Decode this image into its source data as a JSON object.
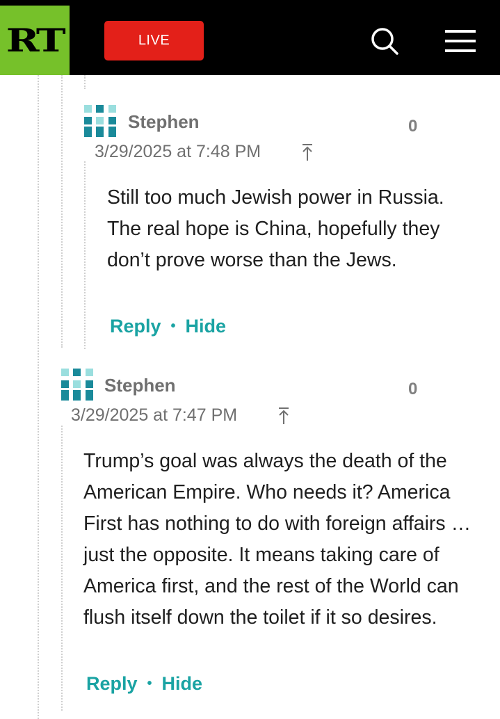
{
  "header": {
    "logo": "RT",
    "live_label": "LIVE"
  },
  "comments": [
    {
      "author": "Stephen",
      "votes": "0",
      "timestamp": "3/29/2025 at 7:48 PM",
      "body": "Still too much Jewish power in Russia. The real hope is China, hopefully they don’t prove worse than the Jews.",
      "reply_label": "Reply",
      "hide_label": "Hide"
    },
    {
      "author": "Stephen",
      "votes": "0",
      "timestamp": "3/29/2025 at 7:47 PM",
      "body": "Trump’s goal was always the death of the American Empire. Who needs it? America First has nothing to do with foreign affairs … just the opposite. It means taking care of America first, and the rest of the World can flush itself down the toilet if it so desires.",
      "reply_label": "Reply",
      "hide_label": "Hide"
    }
  ],
  "colors": {
    "header_bg": "#000000",
    "logo_bg": "#76c12a",
    "live_bg": "#e32019",
    "action_link": "#1aa3a3",
    "muted_text": "#707070"
  }
}
